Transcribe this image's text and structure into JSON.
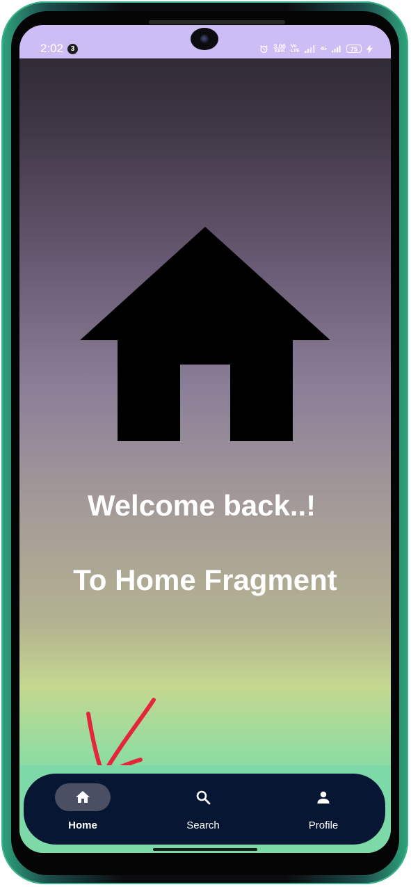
{
  "status_bar": {
    "time": "2:02",
    "notification_count": "3",
    "network_speed_value": "3.00",
    "network_speed_unit": "KB/S",
    "volte_top": "Vo",
    "volte_bottom": "LTE",
    "network_type": "4G",
    "battery_level": "75"
  },
  "main": {
    "welcome_line_1": "Welcome back..!",
    "welcome_line_2": "To Home Fragment",
    "illustration_icon": "house-icon"
  },
  "bottom_nav": {
    "items": [
      {
        "label": "Home",
        "icon": "home-icon",
        "selected": true
      },
      {
        "label": "Search",
        "icon": "search-icon",
        "selected": false
      },
      {
        "label": "Profile",
        "icon": "person-icon",
        "selected": false
      }
    ]
  },
  "annotation": {
    "icon": "red-arrow-annotation",
    "color": "#e3263a"
  },
  "colors": {
    "status_bar": "#cdbdf5",
    "nav_background": "#061633",
    "nav_selected_pill": "#4a4f63",
    "gradient_top": "#2a2430",
    "gradient_bottom": "#62d4a8"
  }
}
